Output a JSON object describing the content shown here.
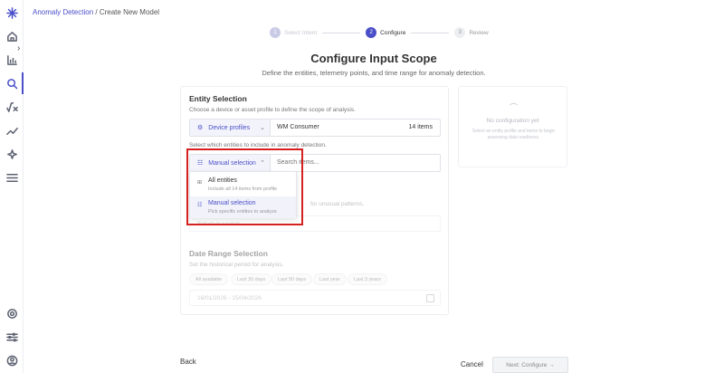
{
  "breadcrumb": {
    "parent": "Anomaly Detection",
    "separator": " / ",
    "current": "Create New Model"
  },
  "stepper": {
    "steps": [
      {
        "num": "1",
        "label": "Select Intent"
      },
      {
        "num": "2",
        "label": "Configure"
      },
      {
        "num": "3",
        "label": "Review"
      }
    ]
  },
  "header": {
    "title": "Configure Input Scope",
    "subtitle": "Define the entities, telemetry points, and time range for anomaly detection."
  },
  "entity": {
    "title": "Entity Selection",
    "description": "Choose a device or asset profile to define the scope of analysis.",
    "profile_type": "Device profiles",
    "profile_value": "WM Consumer",
    "profile_count": "14 items",
    "select_hint": "Select which entities to include in anomaly detection.",
    "mode": "Manual selection",
    "search_placeholder": "Search items..."
  },
  "menu": {
    "items": [
      {
        "label": "All entities",
        "desc": "Include all 14 items from profile"
      },
      {
        "label": "Manual selection",
        "desc": "Pick specific entities to analyze"
      }
    ]
  },
  "telemetry": {
    "hint": "for unusual patterns.",
    "placeholder": "Select or search..."
  },
  "date_range": {
    "title": "Date Range Selection",
    "description": "Set the historical period for analysis.",
    "chips": [
      "All available",
      "Last 30 days",
      "Last 90 days",
      "Last year",
      "Last 3 years"
    ],
    "value": "16/01/2026 - 15/04/2026"
  },
  "side_panel": {
    "title": "No configuration yet",
    "description": "Select an entity profile and items to begin assessing data readiness."
  },
  "footer": {
    "back": "Back",
    "cancel": "Cancel",
    "next": "Next: Configure →"
  },
  "colors": {
    "accent": "#4a4fc9",
    "highlight": "#d62020"
  }
}
